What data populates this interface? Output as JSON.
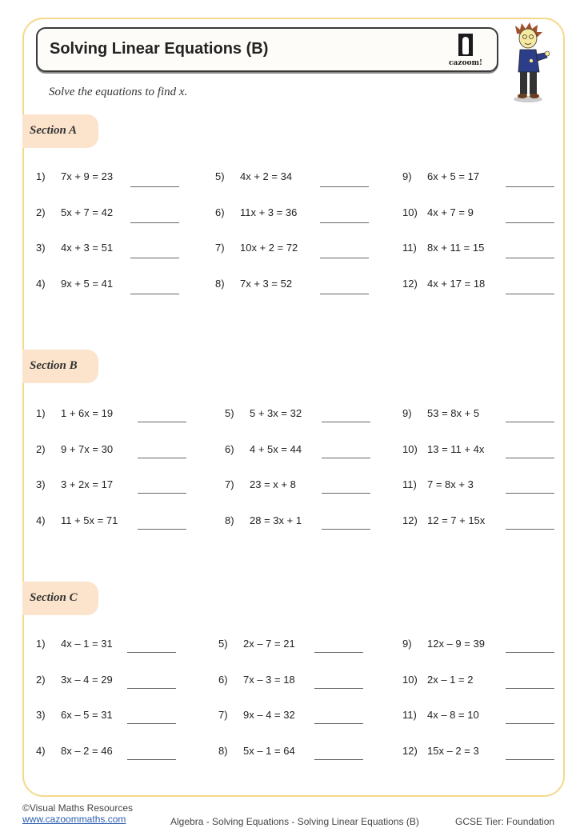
{
  "header": {
    "title": "Solving Linear Equations (B)",
    "logo_text": "cazoom!",
    "instruction": "Solve the equations to find x."
  },
  "sections": [
    {
      "label": "Section A",
      "questions": [
        {
          "num": "1)",
          "eq": "7x + 9 = 23"
        },
        {
          "num": "2)",
          "eq": "5x + 7 = 42"
        },
        {
          "num": "3)",
          "eq": "4x + 3 = 51"
        },
        {
          "num": "4)",
          "eq": "9x + 5 = 41"
        },
        {
          "num": "5)",
          "eq": "4x + 2 = 34"
        },
        {
          "num": "6)",
          "eq": "11x + 3 = 36"
        },
        {
          "num": "7)",
          "eq": "10x + 2 = 72"
        },
        {
          "num": "8)",
          "eq": "7x + 3 = 52"
        },
        {
          "num": "9)",
          "eq": "6x + 5 = 17"
        },
        {
          "num": "10)",
          "eq": "4x + 7 = 9"
        },
        {
          "num": "11)",
          "eq": "8x + 11 = 15"
        },
        {
          "num": "12)",
          "eq": "4x + 17 = 18"
        }
      ]
    },
    {
      "label": "Section B",
      "questions": [
        {
          "num": "1)",
          "eq": "1 + 6x = 19"
        },
        {
          "num": "2)",
          "eq": "9 + 7x = 30"
        },
        {
          "num": "3)",
          "eq": "3 + 2x = 17"
        },
        {
          "num": "4)",
          "eq": "11 + 5x = 71"
        },
        {
          "num": "5)",
          "eq": "5 + 3x = 32"
        },
        {
          "num": "6)",
          "eq": "4 + 5x = 44"
        },
        {
          "num": "7)",
          "eq": "23 = x + 8"
        },
        {
          "num": "8)",
          "eq": "28 = 3x + 1"
        },
        {
          "num": "9)",
          "eq": "53 = 8x + 5"
        },
        {
          "num": "10)",
          "eq": "13 = 11 + 4x"
        },
        {
          "num": "11)",
          "eq": "7 = 8x + 3"
        },
        {
          "num": "12)",
          "eq": "12 = 7 + 15x"
        }
      ]
    },
    {
      "label": "Section C",
      "questions": [
        {
          "num": "1)",
          "eq": "4x – 1 = 31"
        },
        {
          "num": "2)",
          "eq": "3x – 4 = 29"
        },
        {
          "num": "3)",
          "eq": "6x – 5 = 31"
        },
        {
          "num": "4)",
          "eq": "8x – 2 = 46"
        },
        {
          "num": "5)",
          "eq": "2x – 7 = 21"
        },
        {
          "num": "6)",
          "eq": "7x – 3 = 18"
        },
        {
          "num": "7)",
          "eq": "9x – 4 = 32"
        },
        {
          "num": "8)",
          "eq": "5x – 1 = 64"
        },
        {
          "num": "9)",
          "eq": "12x – 9 = 39"
        },
        {
          "num": "10)",
          "eq": "2x – 1 = 2"
        },
        {
          "num": "11)",
          "eq": "4x – 8 = 10"
        },
        {
          "num": "12)",
          "eq": "15x – 2 = 3"
        }
      ]
    }
  ],
  "footer": {
    "copyright": "©Visual Maths Resources",
    "website": "www.cazoommaths.com",
    "topic": "Algebra - Solving Equations - Solving Linear Equations (B)",
    "tier": "GCSE Tier: Foundation"
  },
  "colors": {
    "frame_border": "#f5d88a",
    "section_badge": "#fbe3cc",
    "link": "#2a5db0"
  }
}
